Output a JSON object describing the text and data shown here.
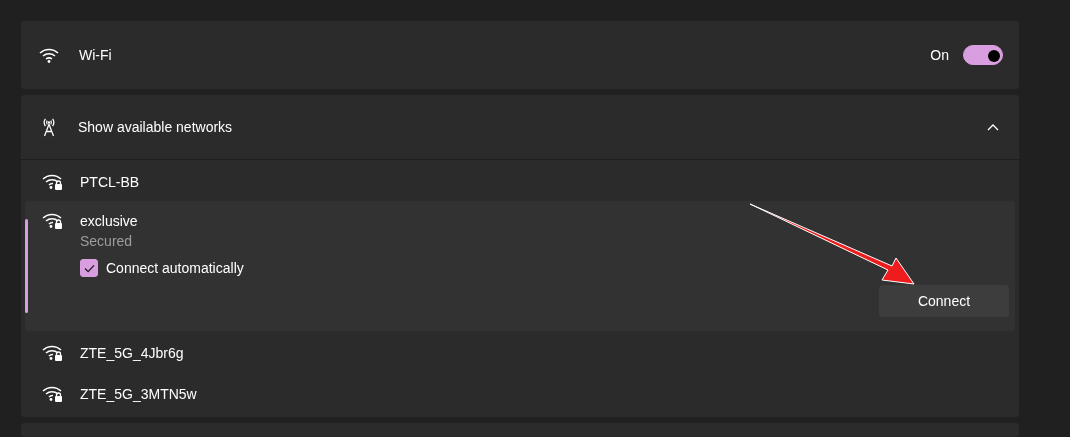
{
  "wifi": {
    "label": "Wi-Fi",
    "state_label": "On",
    "on": true
  },
  "networks": {
    "header": "Show available networks",
    "expanded": true,
    "items": [
      {
        "name": "PTCL-BB",
        "selected": false
      },
      {
        "name": "exclusive",
        "selected": true,
        "status": "Secured",
        "auto_connect": {
          "label": "Connect automatically",
          "checked": true
        },
        "button": "Connect"
      },
      {
        "name": "ZTE_5G_4Jbr6g",
        "selected": false
      },
      {
        "name": "ZTE_5G_3MTN5w",
        "selected": false
      }
    ]
  }
}
